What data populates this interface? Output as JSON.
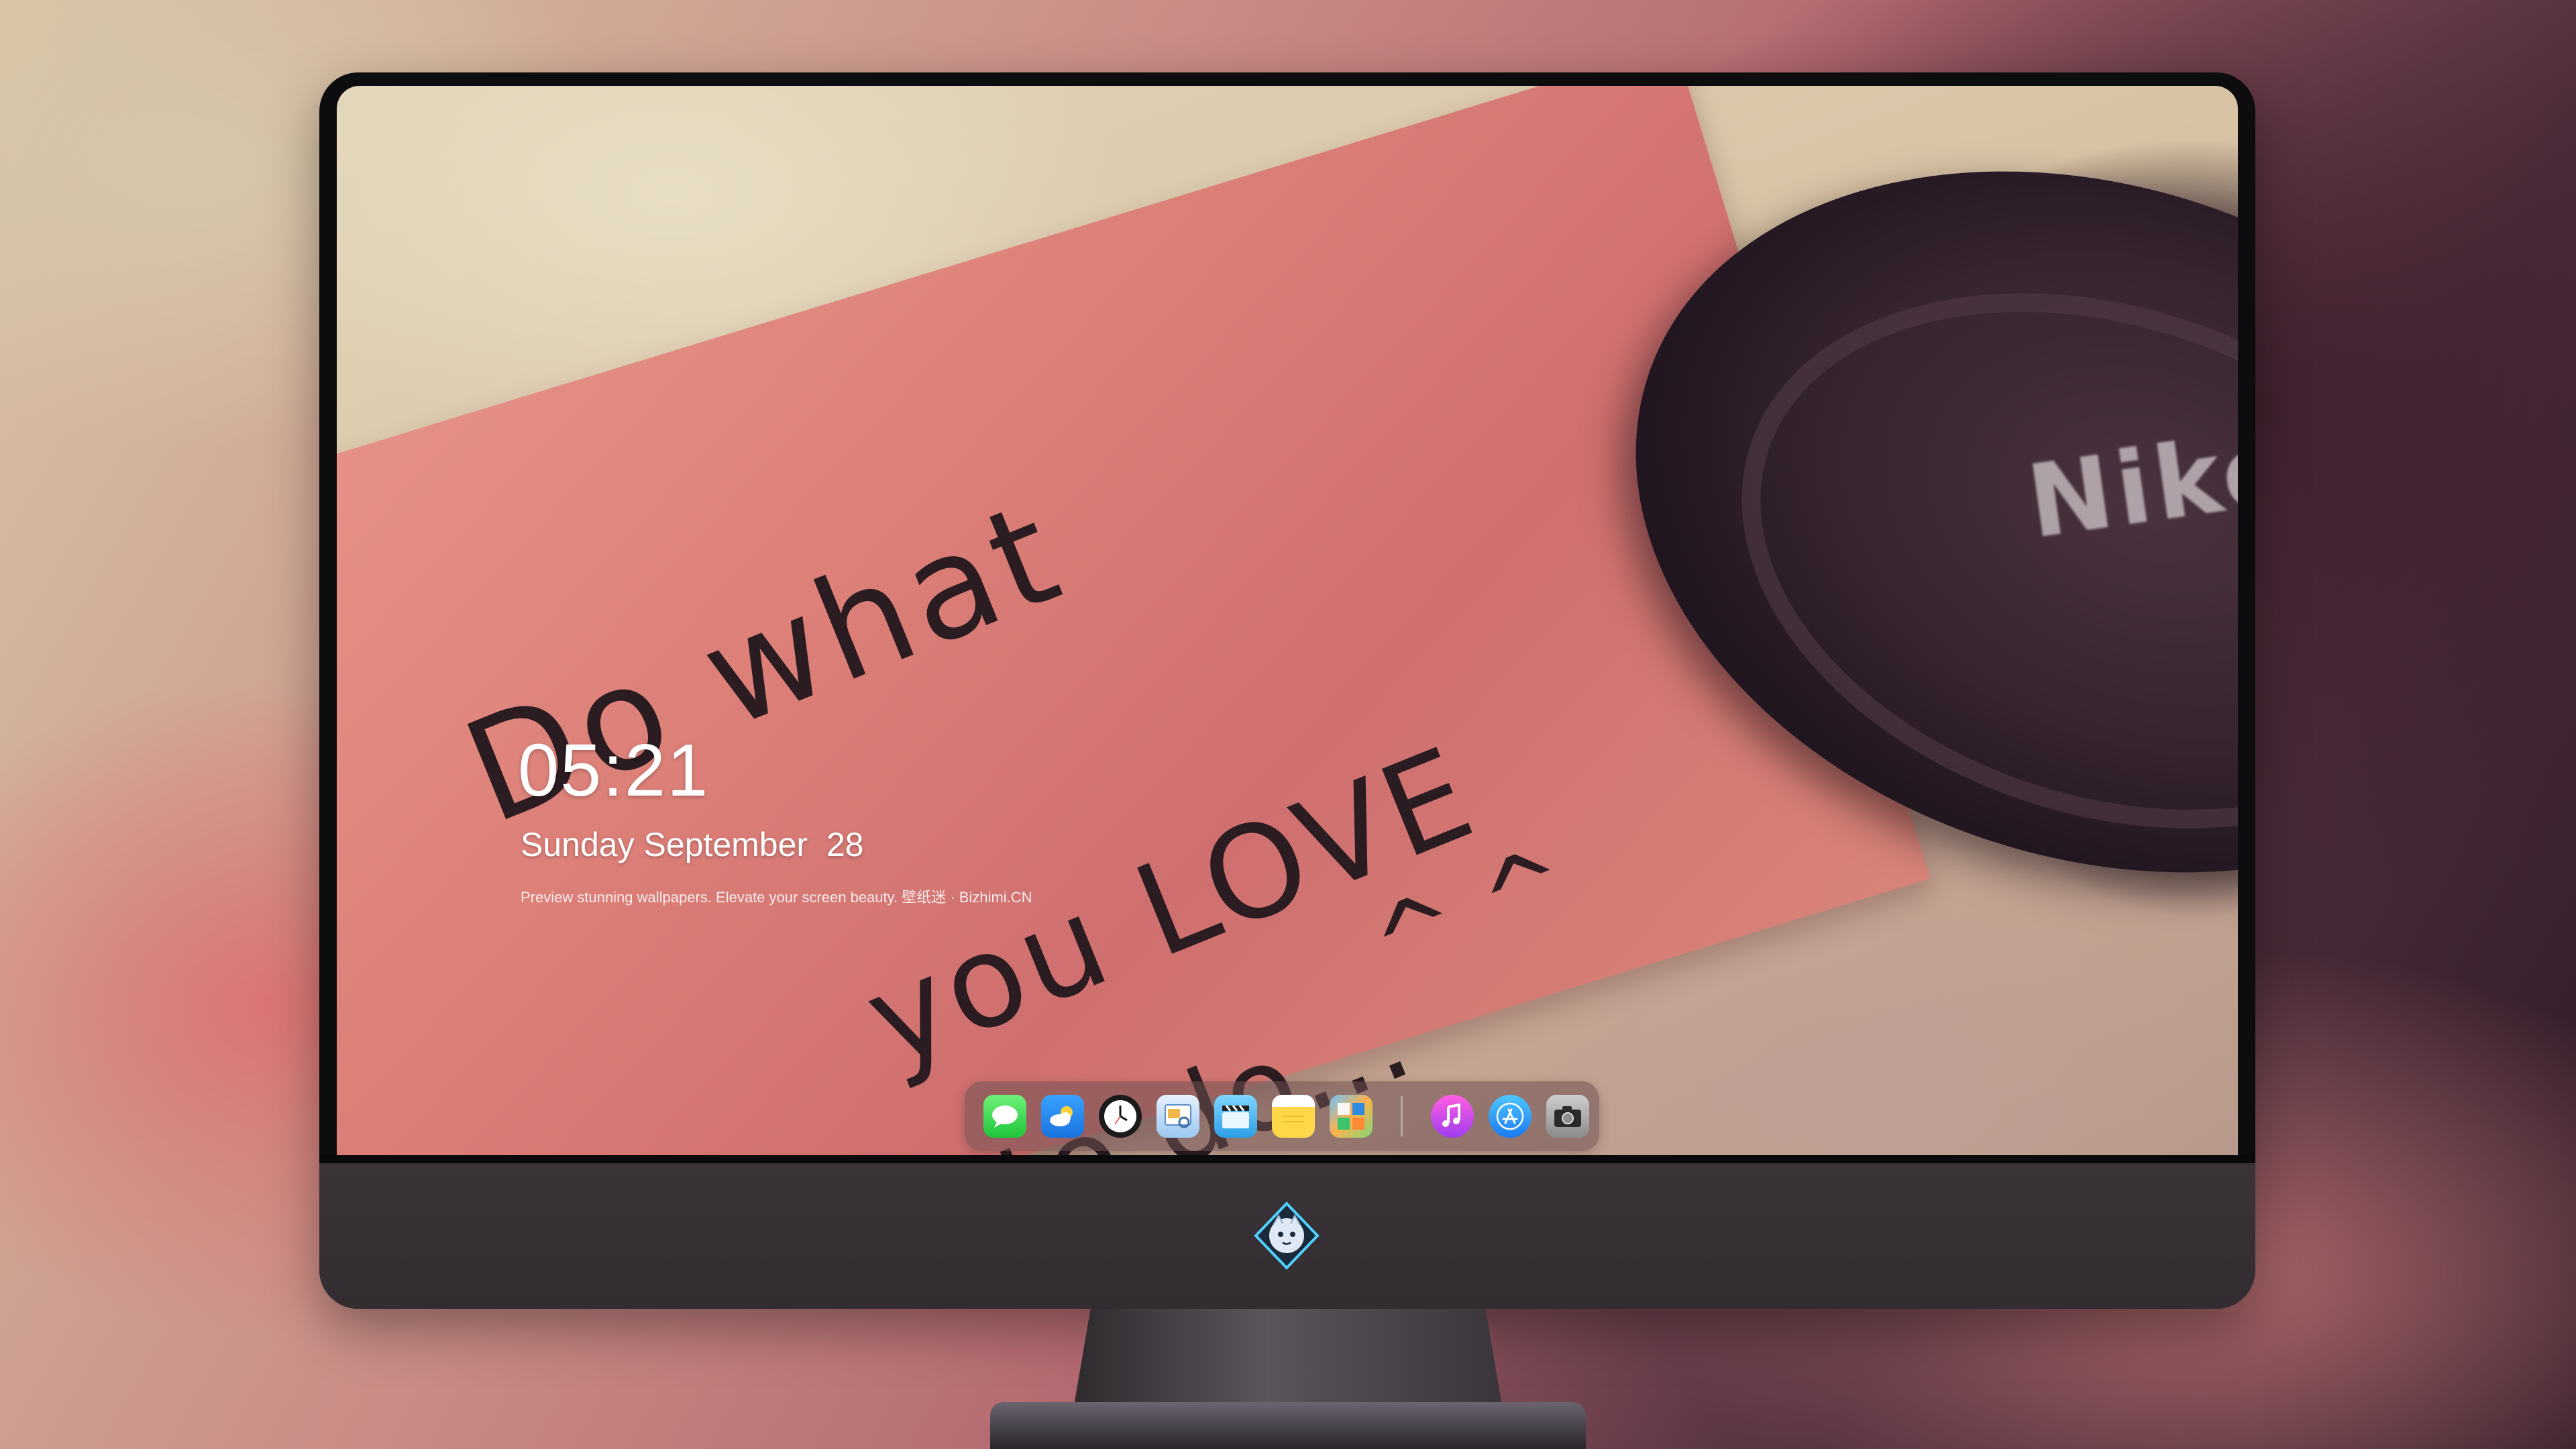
{
  "lock_screen": {
    "time": "05:21",
    "date": "Sunday September  28",
    "tagline": "Preview stunning wallpapers. Elevate your screen beauty. 壁纸迷 · Bizhimi.CN"
  },
  "wallpaper": {
    "note_line_1": "Do what",
    "note_line_2": "you LOVE",
    "note_line_3": "to do...",
    "note_face": "^ ^",
    "lens_cap_brand": "Nikon"
  },
  "dock": {
    "apps": [
      {
        "name": "Messages",
        "icon": "speech-bubble-icon"
      },
      {
        "name": "Weather",
        "icon": "cloud-sun-icon"
      },
      {
        "name": "Clock",
        "icon": "clock-icon"
      },
      {
        "name": "Preview",
        "icon": "preview-icon"
      },
      {
        "name": "Clips",
        "icon": "clapperboard-icon"
      },
      {
        "name": "Notes",
        "icon": "notepad-icon"
      },
      {
        "name": "Photo Booth",
        "icon": "photo-collage-icon"
      },
      {
        "name": "Music",
        "icon": "music-note-icon"
      },
      {
        "name": "App Store",
        "icon": "app-store-icon"
      },
      {
        "name": "Camera",
        "icon": "camera-icon"
      }
    ]
  },
  "colors": {
    "note_pink": "#dc8078",
    "dock_bg": "#6e5050",
    "bezel": "#0d0d10",
    "chin": "#3a3438"
  }
}
